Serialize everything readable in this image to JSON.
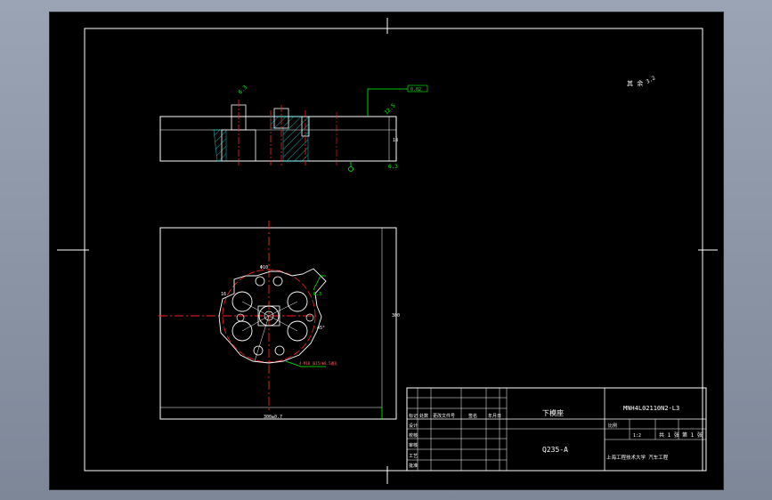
{
  "drawing": {
    "roughness_note": "其 余",
    "roughness_value": "3.2",
    "label_callout_top": "6.3",
    "label_callout_side": "12.5",
    "label_flatness": "0.02",
    "label_dim_side": "18",
    "label_bottom_width": "300±0.7",
    "label_right_height": "300",
    "label_bolt_spec": "4-M10 深15/Φ8.5通孔",
    "label_hole_small": "Φ10",
    "label_angle": "45°",
    "label_slot": "16"
  },
  "title_block": {
    "part_name": "下模座",
    "material": "Q235-A",
    "drawing_no": "MNH4L02110N2-L3",
    "header_cells": [
      "标记",
      "处数",
      "分区",
      "更改文件号",
      "签名",
      "年月日"
    ],
    "row_labels": [
      "设计",
      "校核",
      "审核",
      "工艺",
      "批准"
    ],
    "scale_label": "比例",
    "scale_value": "1:2",
    "sheet_label": "共 1 张",
    "sheet_of": "第 1 张",
    "school_text": "上海工程技术大学 汽车工程"
  }
}
